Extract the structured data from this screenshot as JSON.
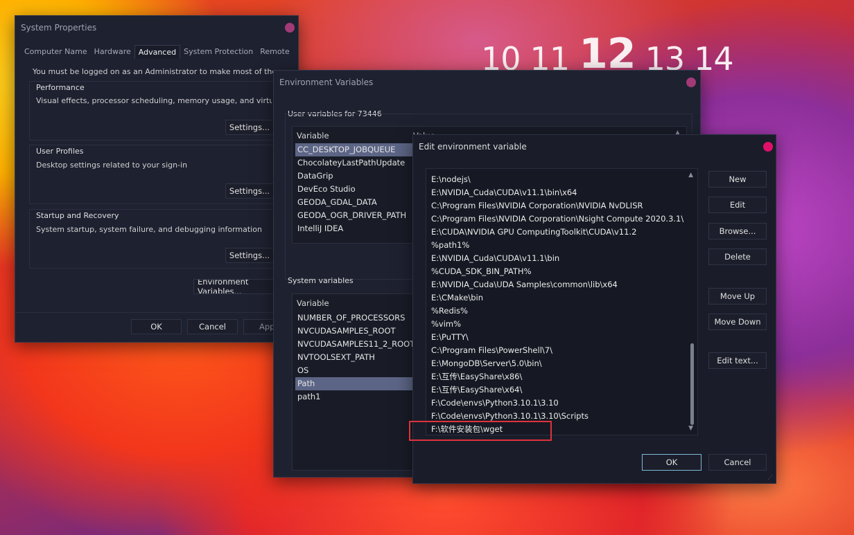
{
  "clock": {
    "prev2": "10",
    "prev1": "11",
    "current": "12",
    "next1": "13",
    "next2": "14"
  },
  "sysprops": {
    "title": "System Properties",
    "tabs": [
      "Computer Name",
      "Hardware",
      "Advanced",
      "System Protection",
      "Remote"
    ],
    "active_tab": "Advanced",
    "admin_note": "You must be logged on as an Administrator to make most of these changes",
    "performance": {
      "label": "Performance",
      "desc": "Visual effects, processor scheduling, memory usage, and virtual memory",
      "button": "Settings..."
    },
    "profiles": {
      "label": "User Profiles",
      "desc": "Desktop settings related to your sign-in",
      "button": "Settings..."
    },
    "startup": {
      "label": "Startup and Recovery",
      "desc": "System startup, system failure, and debugging information",
      "button": "Settings..."
    },
    "env_button": "Environment Variables...",
    "ok": "OK",
    "cancel": "Cancel",
    "apply": "Apply"
  },
  "envvars": {
    "title": "Environment Variables",
    "user_group_label": "User variables for 73446",
    "col_variable": "Variable",
    "col_value": "Value",
    "user_vars": [
      "CC_DESKTOP_JOBQUEUE",
      "ChocolateyLastPathUpdate",
      "DataGrip",
      "DevEco Studio",
      "GEODA_GDAL_DATA",
      "GEODA_OGR_DRIVER_PATH",
      "IntelliJ IDEA"
    ],
    "system_group_label": "System variables",
    "system_vars": [
      "NUMBER_OF_PROCESSORS",
      "NVCUDASAMPLES_ROOT",
      "NVCUDASAMPLES11_2_ROOT",
      "NVTOOLSEXT_PATH",
      "OS",
      "Path",
      "path1"
    ]
  },
  "editenv": {
    "title": "Edit environment variable",
    "paths": [
      "E:\\nodejs\\",
      "E:\\NVIDIA_Cuda\\CUDA\\v11.1\\bin\\x64",
      "C:\\Program Files\\NVIDIA Corporation\\NVIDIA NvDLISR",
      "C:\\Program Files\\NVIDIA Corporation\\Nsight Compute 2020.3.1\\",
      "E:\\CUDA\\NVIDIA GPU ComputingToolkit\\CUDA\\v11.2",
      "%path1%",
      "E:\\NVIDIA_Cuda\\CUDA\\v11.1\\bin",
      "%CUDA_SDK_BIN_PATH%",
      "E:\\NVIDIA_Cuda\\UDA Samples\\common\\lib\\x64",
      "E:\\CMake\\bin",
      "%Redis%",
      "%vim%",
      "E:\\PuTTY\\",
      "C:\\Program Files\\PowerShell\\7\\",
      "E:\\MongoDB\\Server\\5.0\\bin\\",
      "E:\\互传\\EasyShare\\x86\\",
      "E:\\互传\\EasyShare\\x64\\",
      "F:\\Code\\envs\\Python3.10.1\\3.10",
      "F:\\Code\\envs\\Python3.10.1\\3.10\\Scripts",
      "F:\\软件安装包\\wget"
    ],
    "buttons": {
      "new": "New",
      "edit": "Edit",
      "browse": "Browse...",
      "delete": "Delete",
      "move_up": "Move Up",
      "move_down": "Move Down",
      "edit_text": "Edit text...",
      "ok": "OK",
      "cancel": "Cancel"
    }
  },
  "colors": {
    "accent_close": "#e0106a",
    "selection": "#5c6585",
    "highlight_box": "#e0323c"
  }
}
